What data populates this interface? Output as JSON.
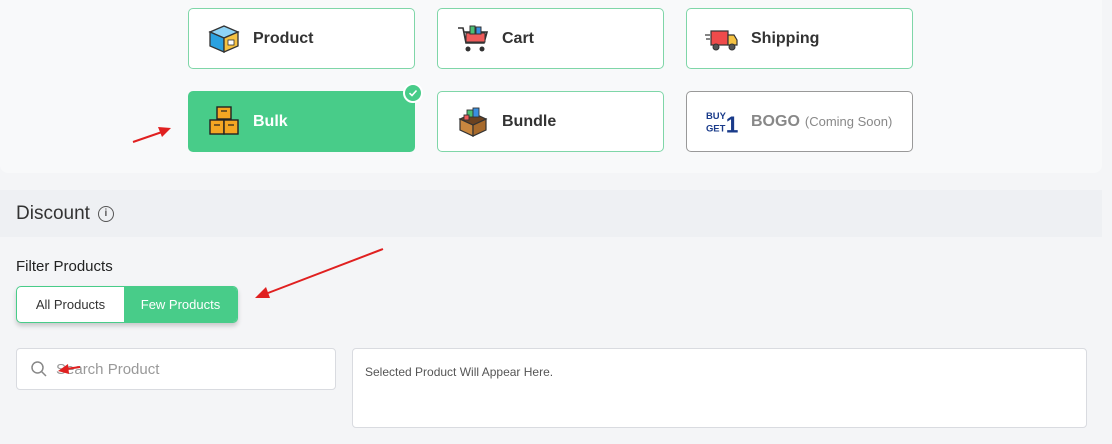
{
  "discount_types": [
    {
      "label": "Product",
      "icon": "product-box-icon"
    },
    {
      "label": "Cart",
      "icon": "cart-icon"
    },
    {
      "label": "Shipping",
      "icon": "shipping-truck-icon"
    },
    {
      "label": "Bulk",
      "icon": "bulk-boxes-icon",
      "selected": true
    },
    {
      "label": "Bundle",
      "icon": "bundle-box-icon"
    },
    {
      "label": "BOGO",
      "sub": "(Coming Soon)",
      "icon": "buy-get-1-icon",
      "icon_text_top": "BUY",
      "icon_text_bottom": "GET",
      "icon_text_num": "1"
    }
  ],
  "discount": {
    "title": "Discount",
    "info_icon": "info-icon"
  },
  "filter": {
    "label": "Filter Products",
    "options": [
      "All Products",
      "Few Products"
    ],
    "selected": "Few Products"
  },
  "search": {
    "placeholder": "Search Product",
    "icon": "search-icon"
  },
  "selected_products": {
    "empty_text": "Selected Product Will Appear Here."
  },
  "colors": {
    "accent": "#48cc89",
    "annotation_arrow": "#e02020"
  }
}
